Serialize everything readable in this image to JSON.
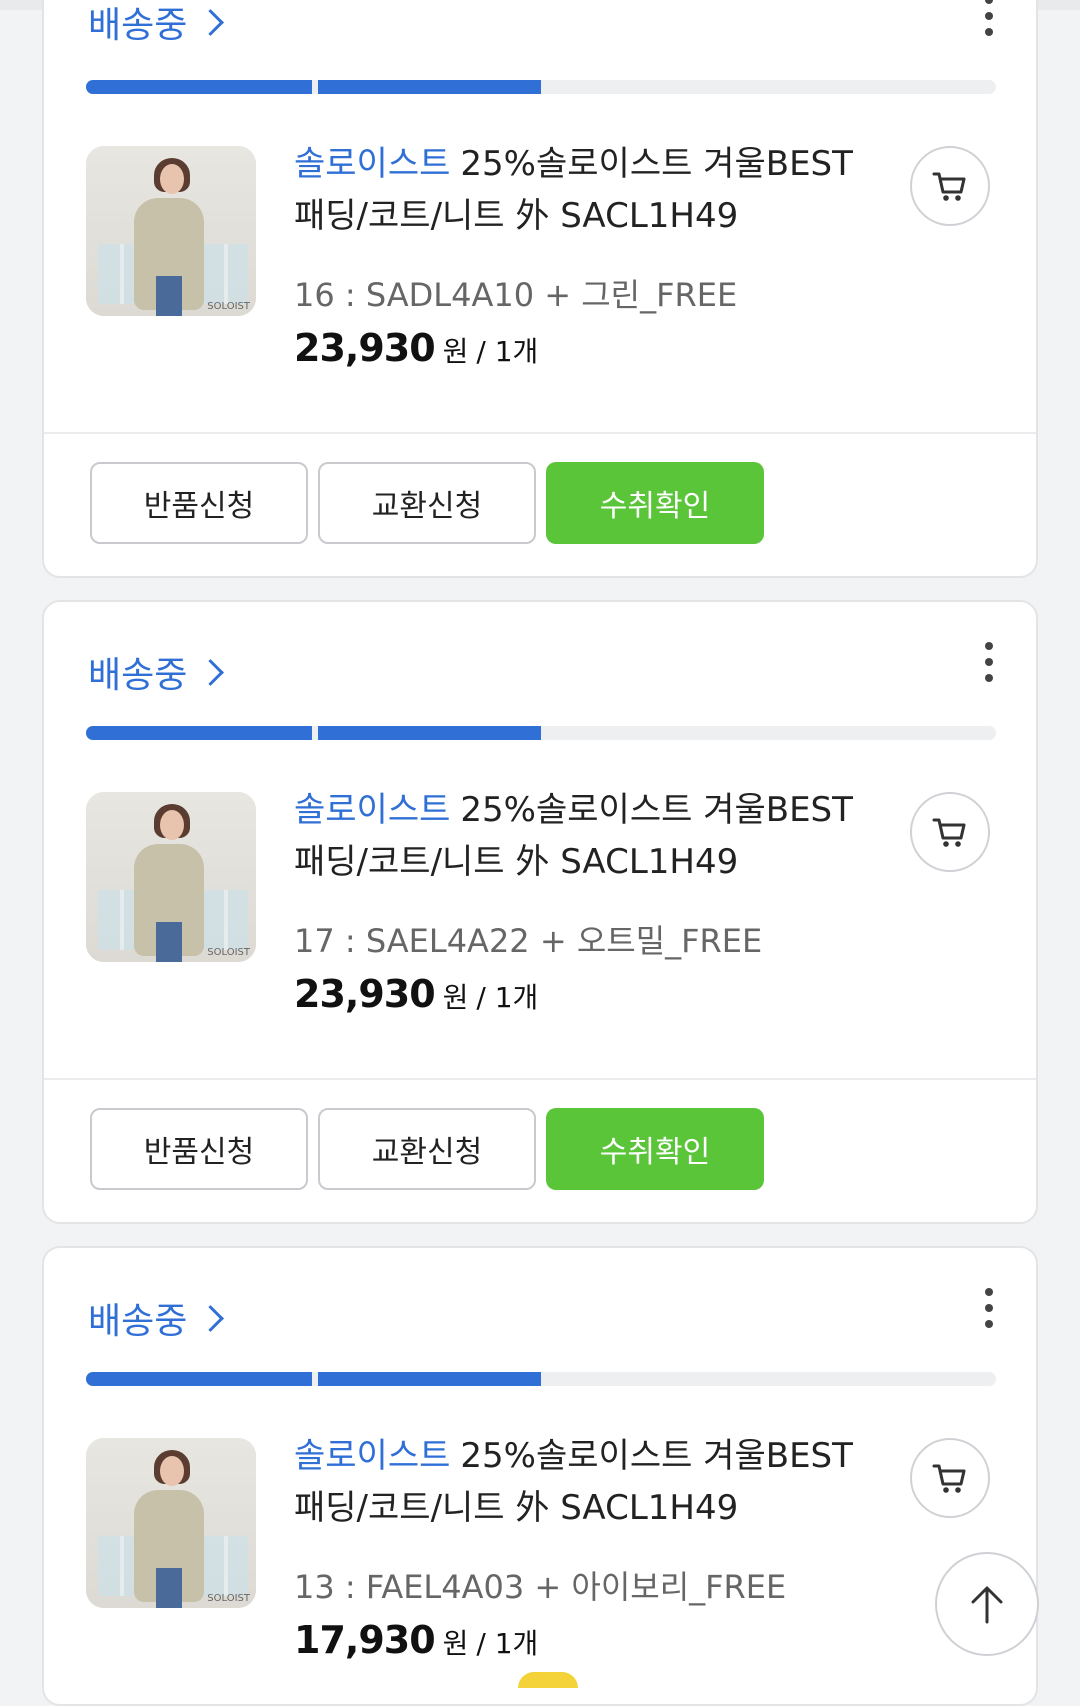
{
  "cards": [
    {
      "status": "배송중",
      "brand": "솔로이스트",
      "name_line1": "25%솔로이스트 겨울BEST",
      "name_line2": "패딩/코트/니트 外 SACL1H49",
      "option": "16 : SADL4A10 + 그린_FREE",
      "price": "23,930",
      "currency": "원",
      "qty": "/ 1개",
      "buttons": [
        "반품신청",
        "교환신청",
        "수취확인"
      ]
    },
    {
      "status": "배송중",
      "brand": "솔로이스트",
      "name_line1": "25%솔로이스트 겨울BEST",
      "name_line2": "패딩/코트/니트 外 SACL1H49",
      "option": "17 : SAEL4A22 + 오트밀_FREE",
      "price": "23,930",
      "currency": "원",
      "qty": "/ 1개",
      "buttons": [
        "반품신청",
        "교환신청",
        "수취확인"
      ]
    },
    {
      "status": "배송중",
      "brand": "솔로이스트",
      "name_line1": "25%솔로이스트 겨울BEST",
      "name_line2": "패딩/코트/니트 外 SACL1H49",
      "option": "13 : FAEL4A03 + 아이보리_FREE",
      "price": "17,930",
      "currency": "원",
      "qty": "/ 1개"
    }
  ],
  "thumb_logo": "SOLOIST",
  "icons": {
    "cart": "cart-icon",
    "more": "more-vertical-icon",
    "scroll_top": "arrow-up-icon"
  },
  "progress_fraction": 0.5,
  "colors": {
    "accent_blue": "#2f6fd6",
    "confirm_green": "#5bc53a"
  }
}
